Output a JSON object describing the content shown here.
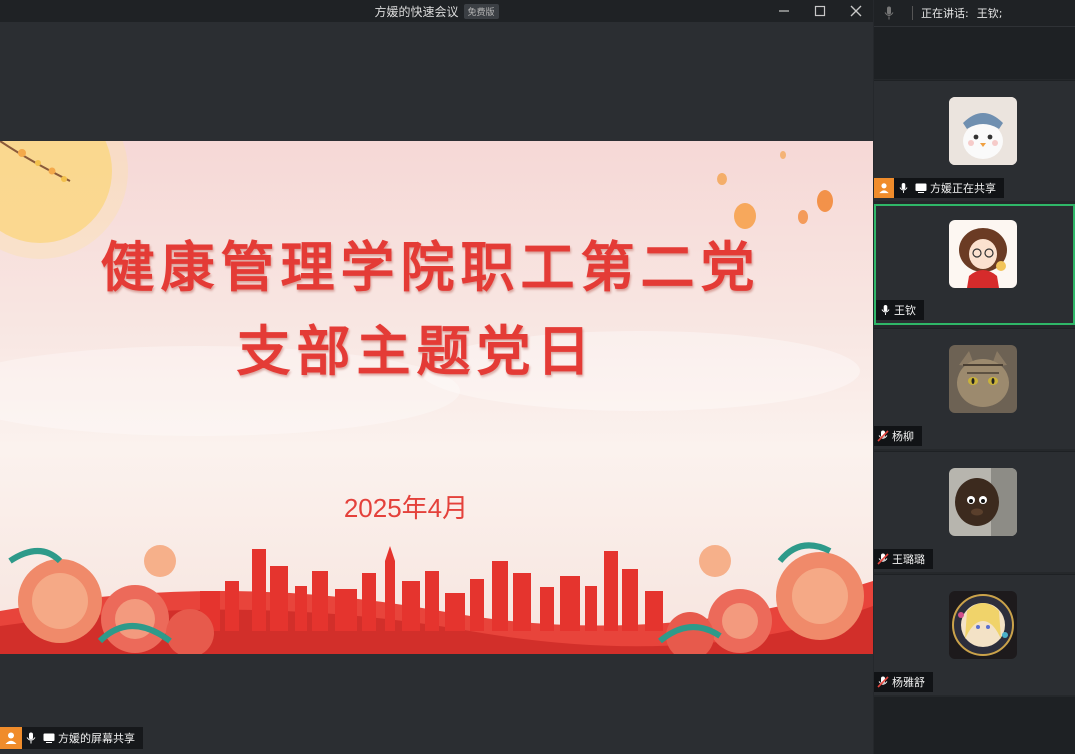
{
  "window": {
    "title": "方媛的快速会议",
    "edition_badge": "免费版",
    "minimize": "—",
    "maximize": "□",
    "close": "✕"
  },
  "slide": {
    "title_line1": "健康管理学院职工第二党",
    "title_line2": "支部主题党日",
    "date": "2025年4月"
  },
  "screen_share_label": "方媛的屏幕共享",
  "speaking": {
    "label": "正在讲话:",
    "speaker": "王钦;"
  },
  "participants": [
    {
      "name": "方媛正在共享",
      "mic": "on",
      "sharing": true,
      "avatar": "cartoon-bird-avatar"
    },
    {
      "name": "王钦",
      "mic": "on",
      "active": true,
      "avatar": "cartoon-girl-avatar"
    },
    {
      "name": "杨柳",
      "mic": "muted",
      "avatar": "cat-photo-avatar"
    },
    {
      "name": "王璐璐",
      "mic": "muted",
      "avatar": "furry-doll-avatar"
    },
    {
      "name": "杨雅舒",
      "mic": "muted",
      "avatar": "anime-circle-avatar"
    }
  ],
  "colors": {
    "accent_green": "#2fb768",
    "share_orange": "#f08c2b",
    "slide_red": "#e43b36"
  }
}
